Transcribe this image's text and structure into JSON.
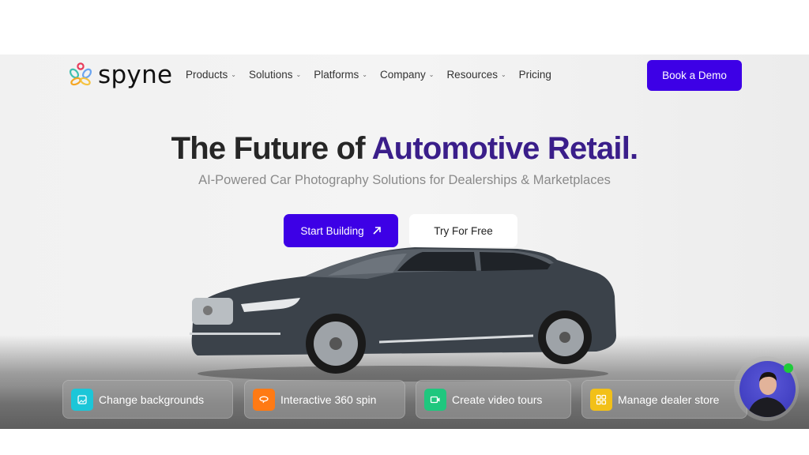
{
  "brand": {
    "name": "spyne"
  },
  "nav": {
    "items": [
      {
        "label": "Products",
        "has_dropdown": true
      },
      {
        "label": "Solutions",
        "has_dropdown": true
      },
      {
        "label": "Platforms",
        "has_dropdown": true
      },
      {
        "label": "Company",
        "has_dropdown": true
      },
      {
        "label": "Resources",
        "has_dropdown": true
      },
      {
        "label": "Pricing",
        "has_dropdown": false
      }
    ],
    "dropdown_icon": "chevron-down-icon",
    "cta_label": "Book a Demo"
  },
  "hero": {
    "headline_plain": "The Future of ",
    "headline_accent": "Automotive Retail.",
    "subheadline": "AI-Powered Car Photography Solutions for Dealerships & Marketplaces",
    "primary_button": "Start Building",
    "primary_button_icon": "arrow-up-right-icon",
    "secondary_button": "Try For Free"
  },
  "features": [
    {
      "label": "Change backgrounds",
      "icon": "image-icon",
      "color": "#1cc6d8"
    },
    {
      "label": "Interactive 360 spin",
      "icon": "rotate-360-icon",
      "color": "#ff7a14"
    },
    {
      "label": "Create video tours",
      "icon": "video-camera-icon",
      "color": "#1fc77e"
    },
    {
      "label": "Manage dealer store",
      "icon": "grid-icon",
      "color": "#f2c018"
    }
  ],
  "chat_widget": {
    "status": "online",
    "status_color": "#1ecb3a"
  },
  "colors": {
    "primary": "#3d00e6",
    "accent_text": "#3a1e8a"
  }
}
